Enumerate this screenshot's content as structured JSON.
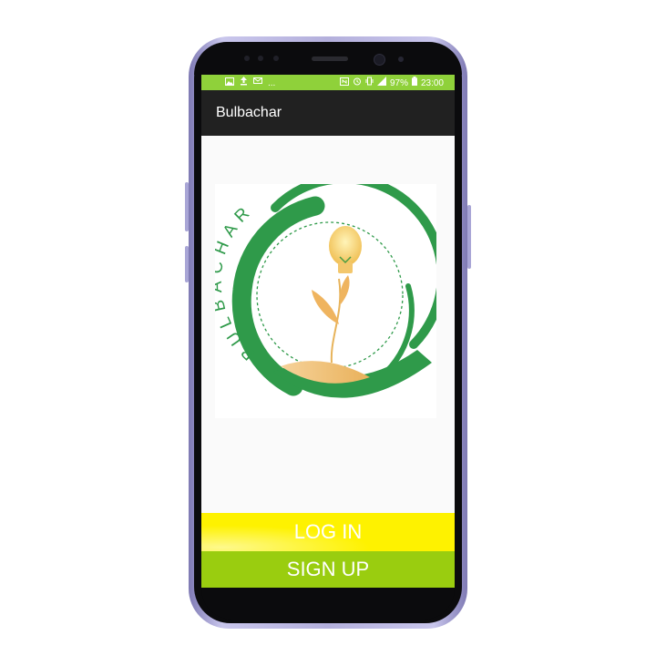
{
  "status_bar": {
    "left_icons": [
      "image-icon",
      "upload-icon",
      "message-icon"
    ],
    "more": "...",
    "right_icons": [
      "nfc-icon",
      "alarm-icon",
      "vibrate-icon",
      "signal-icon"
    ],
    "battery_percent": "97%",
    "time": "23:00"
  },
  "app_bar": {
    "title": "Bulbachar"
  },
  "logo": {
    "text": "BULBACHAR"
  },
  "actions": {
    "login_label": "LOG IN",
    "signup_label": "SIGN UP"
  },
  "colors": {
    "status_bar": "#8fd13a",
    "app_bar": "#212121",
    "login": "#fef200",
    "signup": "#9acd0f",
    "logo_green": "#2f9a4a"
  }
}
